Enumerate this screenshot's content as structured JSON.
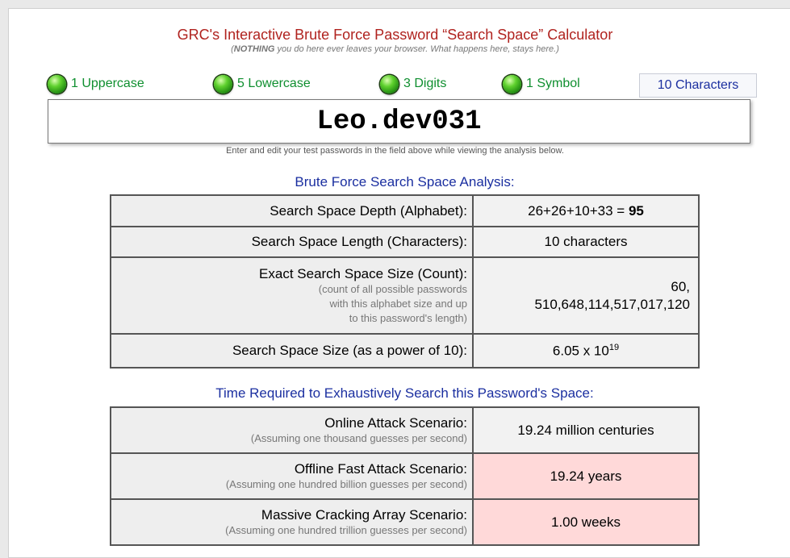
{
  "header": {
    "title": "GRC's Interactive Brute Force Password “Search Space” Calculator",
    "subtitle_bold": "NOTHING",
    "subtitle_rest": " you do here ever leaves your browser. What happens here, stays here.)"
  },
  "indicators": {
    "uppercase": "1 Uppercase",
    "lowercase": "5 Lowercase",
    "digits": "3 Digits",
    "symbol": "1 Symbol",
    "characters": "10 Characters"
  },
  "password": {
    "value": "Leo.dev031"
  },
  "hint": "Enter and edit your test passwords in the field above while viewing the analysis below.",
  "analysis": {
    "heading": "Brute Force Search Space Analysis:",
    "depth_label": "Search Space Depth (Alphabet):",
    "depth_formula": "26+26+10+33 = ",
    "depth_total": "95",
    "length_label": "Search Space Length (Characters):",
    "length_value": "10 characters",
    "exact_label": "Exact Search Space Size (Count):",
    "exact_note_1": "(count of all possible passwords",
    "exact_note_2": "with this alphabet size and up",
    "exact_note_3": "to this password's length)",
    "exact_value_1": "60,",
    "exact_value_2": "510,648,114,517,017,120",
    "power_label": "Search Space Size (as a power of 10):",
    "power_base": "6.05 x 10",
    "power_exp": "19"
  },
  "time": {
    "heading": "Time Required to Exhaustively Search this Password's Space:",
    "online_label": "Online Attack Scenario:",
    "online_note": "(Assuming one thousand guesses per second)",
    "online_value": "19.24 million centuries",
    "offline_label": "Offline Fast Attack Scenario:",
    "offline_note": "(Assuming one hundred billion guesses per second)",
    "offline_value": "19.24 years",
    "massive_label": "Massive Cracking Array Scenario:",
    "massive_note": "(Assuming one hundred trillion guesses per second)",
    "massive_value": "1.00 weeks"
  },
  "colors": {
    "title": "#b0231f",
    "heading": "#1b2fa0",
    "indicator_text": "#0f8f2f",
    "warning_cell": "#ffd9d9"
  }
}
